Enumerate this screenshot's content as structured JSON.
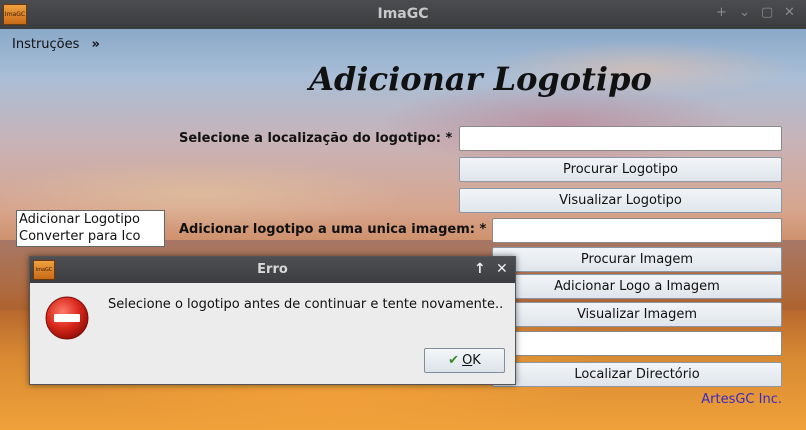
{
  "window": {
    "title": "ImaGC",
    "icon_label": "ImaGC",
    "controls": [
      "+",
      "⌄",
      "▢",
      "✕"
    ]
  },
  "menu": {
    "label": "Instruções",
    "arrow": "»"
  },
  "heading": "Adicionar Logotipo",
  "logo_section": {
    "label": "Selecione a localização do logotipo: *",
    "field_value": "",
    "browse_button": "Procurar Logotipo",
    "view_button": "Visualizar Logotipo"
  },
  "image_section": {
    "label": "Adicionar logotipo a uma unica imagem: *",
    "field_value": "",
    "browse_button": "Procurar Imagem",
    "add_button": "Adicionar Logo a Imagem",
    "view_button": "Visualizar Imagem"
  },
  "directory_section": {
    "field_value": "",
    "button": "Localizar Directório"
  },
  "mode_list": {
    "items": [
      "Adicionar Logotipo",
      "Converter para Ico"
    ]
  },
  "credit": "ArtesGC Inc.",
  "dialog": {
    "title": "Erro",
    "icon_label": "ImaGC",
    "message": "Selecione o logotipo antes de continuar e tente novamente..",
    "ok_label": "OK",
    "ok_mnemonic": "O",
    "ok_rest": "K",
    "icon": "error-stop-icon"
  },
  "colors": {
    "credit": "#3a2ac0",
    "error_red": "#d22a1e",
    "titlebar": "#3f4144"
  }
}
